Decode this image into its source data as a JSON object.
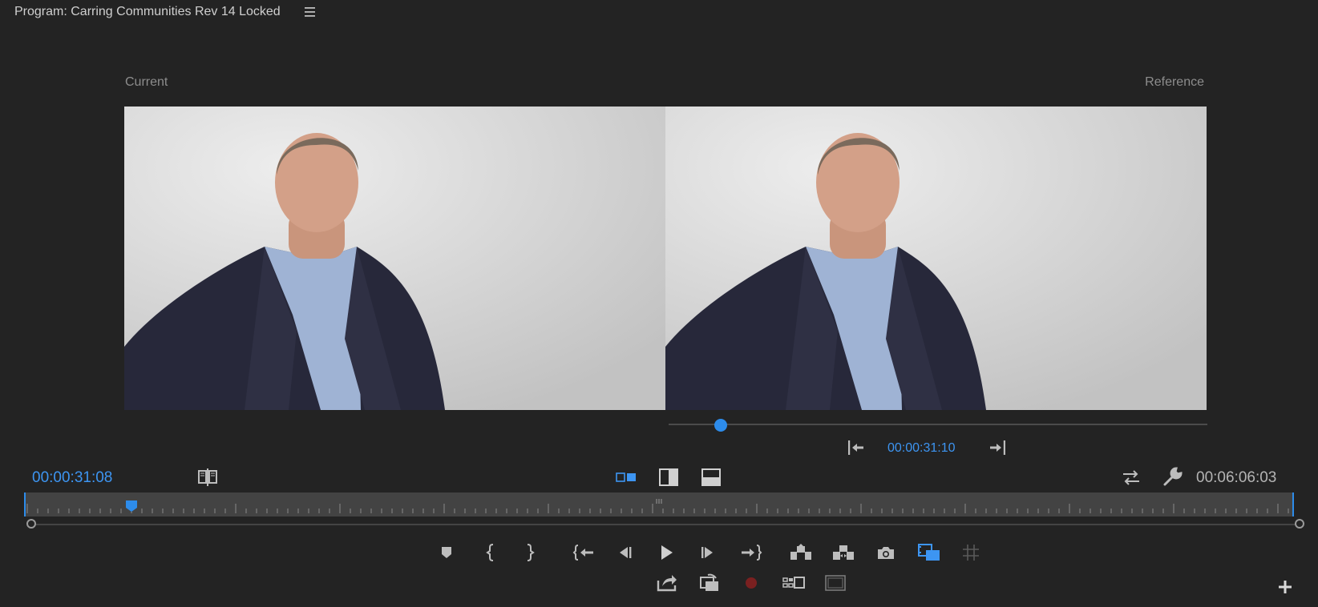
{
  "panel": {
    "title": "Program: Carring Communities Rev 14 Locked",
    "menu_icon": "hamburger-menu-icon"
  },
  "compare": {
    "current_label": "Current",
    "reference_label": "Reference",
    "reference_timecode": "00:00:31:10",
    "reference_playhead_fraction": 0.096
  },
  "monitor": {
    "current_timecode": "00:00:31:08",
    "duration": "00:06:06:03",
    "playhead_fraction": 0.0845,
    "accent_color": "#3d95f2"
  },
  "view_modes": {
    "side_by_side": "side-by-side-view-icon",
    "vertical_split": "vertical-split-icon",
    "horizontal_split": "horizontal-split-icon"
  },
  "icons": {
    "compare_toggle": "compare-view-icon",
    "swap": "swap-sides-icon",
    "settings": "wrench-icon",
    "add_marker": "marker-icon",
    "mark_in": "mark-in-icon",
    "mark_out": "mark-out-icon",
    "go_to_in": "go-to-in-icon",
    "step_back": "step-back-icon",
    "play": "play-icon",
    "step_forward": "step-forward-icon",
    "go_to_out": "go-to-out-icon",
    "lift": "lift-icon",
    "extract": "extract-icon",
    "export_frame": "camera-icon",
    "comparison_view": "comparison-view-icon",
    "safe_margins": "safe-margins-icon",
    "insert": "insert-icon",
    "overwrite": "overwrite-icon",
    "record": "record-icon",
    "multicam": "multicam-icon",
    "vr": "vr-video-icon",
    "add": "add-button-icon",
    "ref_go_in": "reference-go-to-in-icon",
    "ref_go_out": "reference-go-to-out-icon"
  }
}
